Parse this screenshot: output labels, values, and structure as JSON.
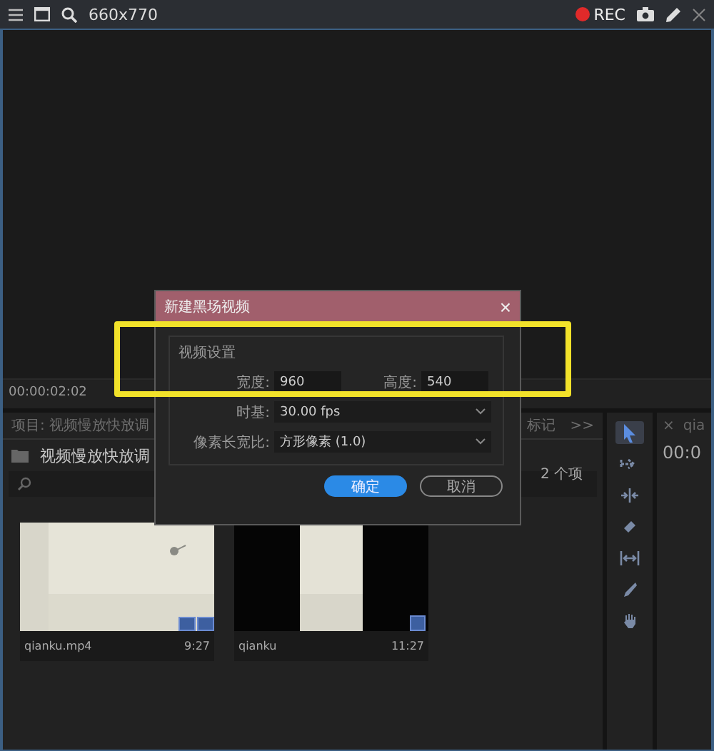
{
  "toolbar": {
    "size": "660x770",
    "rec": "REC"
  },
  "timecode": "00:00:02:02",
  "project_panel": {
    "tab": "项目: 视频慢放快放调",
    "marker_tab": "标记",
    "overflow": ">>",
    "bin_name": "视频慢放快放调",
    "item_count": "2 个项",
    "items": [
      {
        "name": "qianku.mp4",
        "duration": "9:27",
        "kind": "clip"
      },
      {
        "name": "qianku",
        "duration": "11:27",
        "kind": "sequence"
      }
    ]
  },
  "tools": [
    {
      "kind": "select",
      "selected": true
    },
    {
      "kind": "track",
      "selected": false
    },
    {
      "kind": "ripple",
      "selected": false
    },
    {
      "kind": "razor",
      "selected": false
    },
    {
      "kind": "slip",
      "selected": false
    },
    {
      "kind": "pen",
      "selected": false
    },
    {
      "kind": "hand",
      "selected": false
    }
  ],
  "right_panel": {
    "close": "×",
    "tab": "qia",
    "timecode": "00:0"
  },
  "dialog": {
    "title": "新建黑场视频",
    "close": "×",
    "group": "视频设置",
    "fields": [
      {
        "label": "宽度:",
        "value": "960"
      },
      {
        "label": "高度:",
        "value": "540"
      }
    ],
    "selects": [
      {
        "label": "时基:",
        "value": "30.00 fps"
      },
      {
        "label": "像素长宽比:",
        "value": "方形像素 (1.0)"
      }
    ],
    "buttons": [
      {
        "label": "确定",
        "primary": true
      },
      {
        "label": "取消",
        "primary": false
      }
    ]
  }
}
